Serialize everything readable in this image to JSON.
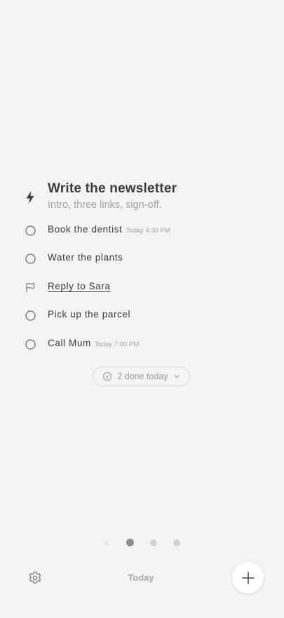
{
  "focus": {
    "icon": "bolt-icon",
    "title": "Write the newsletter",
    "note": "Intro, three links, sign-off."
  },
  "tasks": [
    {
      "label": "Book the dentist",
      "time": "Today 4:30 PM",
      "icon": "circle-checkbox-icon"
    },
    {
      "label": "Water the plants",
      "time": "",
      "icon": "circle-checkbox-icon"
    },
    {
      "label": "Reply to Sara",
      "time": "",
      "icon": "flag-icon",
      "flagged": true
    },
    {
      "label": "Pick up the parcel",
      "time": "",
      "icon": "circle-checkbox-icon"
    },
    {
      "label": "Call Mum",
      "time": "Today 7:00 PM",
      "icon": "circle-checkbox-icon"
    }
  ],
  "done": {
    "label": "2 done today",
    "icon": "check-circle-icon"
  },
  "pager": {
    "count": 4,
    "active_index": 1
  },
  "bottom": {
    "tab_label": "Today",
    "settings_icon": "gear-icon",
    "add_icon": "plus-icon"
  },
  "colors": {
    "background": "#f4f4f4",
    "text": "#3c3c3c",
    "muted": "#a3a3a3",
    "fab": "#ffffff"
  }
}
